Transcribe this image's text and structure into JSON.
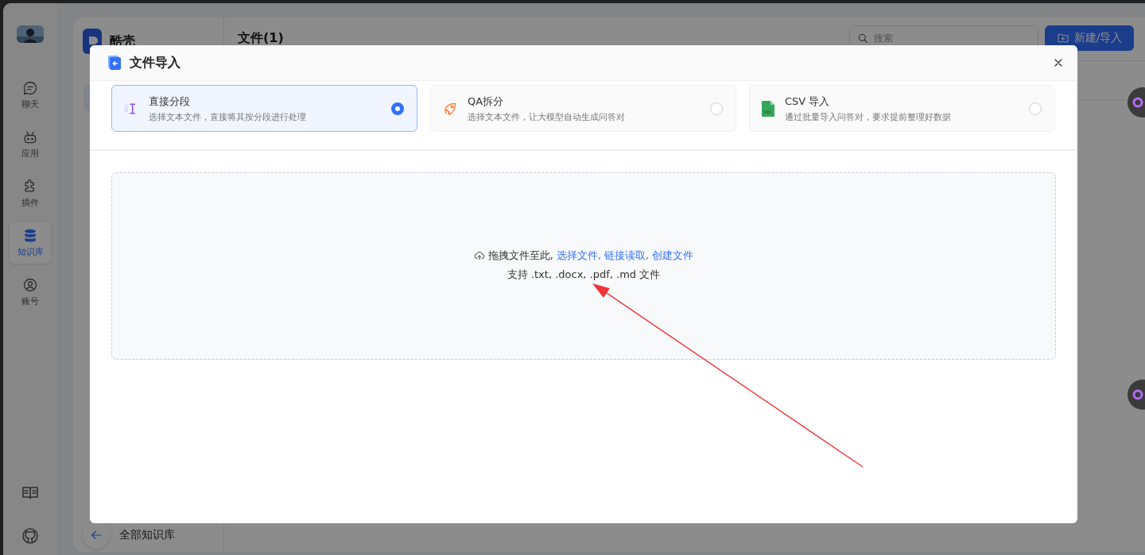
{
  "sidebar": {
    "items": [
      {
        "label": "聊天",
        "selected": false
      },
      {
        "label": "应用",
        "selected": false
      },
      {
        "label": "插件",
        "selected": false
      },
      {
        "label": "知识库",
        "selected": true
      },
      {
        "label": "账号",
        "selected": false
      }
    ]
  },
  "library": {
    "name": "酷壳",
    "back_label": "全部知识库"
  },
  "header": {
    "title": "文件(1)",
    "search": {
      "placeholder": "搜索"
    },
    "new_button": "新建/导入"
  },
  "dialog": {
    "title": "文件导入",
    "modes": [
      {
        "kind": "segment",
        "title": "直接分段",
        "description": "选择文本文件，直接将其按分段进行处理",
        "selected": true
      },
      {
        "kind": "qa",
        "title": "QA拆分",
        "description": "选择文本文件，让大模型自动生成问答对",
        "selected": false
      },
      {
        "kind": "csv",
        "title": "CSV 导入",
        "description": "通过批量导入问答对，要求提前整理好数据",
        "selected": false
      }
    ],
    "dropzone": {
      "prompt": "拖拽文件至此,",
      "links": [
        "选择文件,",
        "链接读取,",
        "创建文件"
      ],
      "hint": "支持 .txt, .docx, .pdf, .md 文件"
    }
  }
}
